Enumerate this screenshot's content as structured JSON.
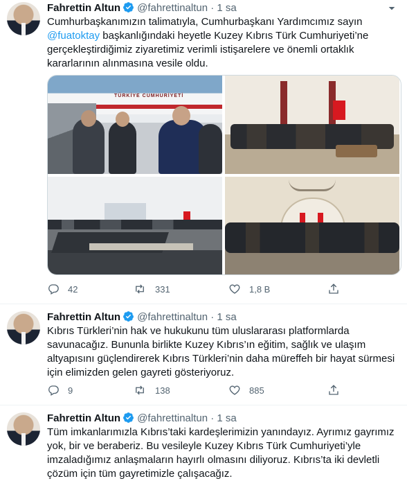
{
  "tweets": [
    {
      "name": "Fahrettin Altun",
      "handle": "@fahrettinaltun",
      "dot": "·",
      "time": "1 sa",
      "text_pre": "Cumhurbaşkanımızın talimatıyla, Cumhurbaşkanı Yardımcımız sayın ",
      "mention": "@fuatoktay",
      "text_post": " başkanlığındaki heyetle Kuzey Kıbrıs Türk Cumhuriyeti’ne gerçekleştirdiğimiz ziyaretimiz verimli istişarelere ve önemli ortaklık kararlarının alınmasına vesile oldu.",
      "replies": "42",
      "retweets": "331",
      "likes": "1,8 B",
      "airplane_text": "TÜRKİYE CUMHURİYETİ"
    },
    {
      "name": "Fahrettin Altun",
      "handle": "@fahrettinaltun",
      "dot": "·",
      "time": "1 sa",
      "text": "Kıbrıs Türkleri’nin hak ve hukukunu tüm uluslararası platformlarda savunacağız. Bununla birlikte Kuzey Kıbrıs’ın eğitim, sağlık ve ulaşım altyapısını güçlendirerek Kıbrıs Türkleri’nin daha müreffeh bir hayat sürmesi için elimizden gelen gayreti gösteriyoruz.",
      "replies": "9",
      "retweets": "138",
      "likes": "885"
    },
    {
      "name": "Fahrettin Altun",
      "handle": "@fahrettinaltun",
      "dot": "·",
      "time": "1 sa",
      "text": "Tüm imkanlarımızla Kıbrıs’taki kardeşlerimizin yanındayız. Ayrımız gayrımız yok, bir ve beraberiz. Bu vesileyle Kuzey Kıbrıs Türk Cumhuriyeti’yle imzaladığımız anlaşmaların hayırlı olmasını diliyoruz. Kıbrıs’ta iki devletli çözüm için tüm gayretimizle çalışacağız."
    }
  ],
  "colors": {
    "accent": "#1d9bf0",
    "muted": "#536471",
    "text": "#0f1419"
  },
  "icons": [
    "verified-badge-icon",
    "more-caret-icon",
    "reply-icon",
    "retweet-icon",
    "like-icon",
    "share-icon"
  ]
}
